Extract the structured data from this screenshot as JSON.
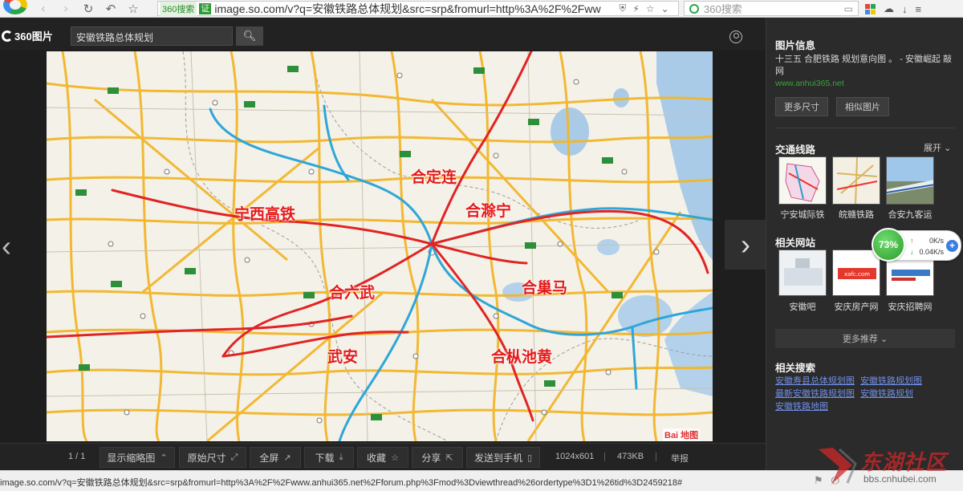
{
  "browser": {
    "url_tag": "360搜索",
    "url_badge": "证",
    "url_text": "image.so.com/v?q=安徽铁路总体规划&src=srp&fromurl=http%3A%2F%2Fww",
    "search_placeholder": "360搜索"
  },
  "site": {
    "logo": "360图片",
    "search_value": "安徽铁路总体规划"
  },
  "map": {
    "labels": [
      "合定连",
      "宁西高铁",
      "合滁宁",
      "合六武",
      "合巢马",
      "武安",
      "合枞池黄"
    ],
    "brand": "Bai 地图"
  },
  "bottom_bar": {
    "page_count": "1 / 1",
    "buttons": [
      "显示缩略图",
      "原始尺寸",
      "全屏",
      "下载",
      "收藏",
      "分享",
      "发送到手机"
    ],
    "dimensions": "1024x601",
    "size": "473KB",
    "report": "举报"
  },
  "sidebar": {
    "info_title": "图片信息",
    "description": "十三五 合肥铁路 规划意向图 。 - 安徽崛起 敲网",
    "source_link": "www.anhui365.net",
    "more_sizes": "更多尺寸",
    "similar": "相似图片",
    "traffic_title": "交通线路",
    "expand": "展开",
    "traffic_items": [
      "宁安城际铁",
      "皖赣铁路",
      "合安九客运"
    ],
    "sites_title": "相关网站",
    "site_items": [
      "安徽吧",
      "安庆房产网",
      "安庆招聘网"
    ],
    "more_recommend": "更多推荐",
    "related_title": "相关搜索",
    "related_links": [
      "安徽寿县总体规划图",
      "安徽铁路规划图",
      "最新安徽铁路规划图",
      "安徽铁路规划",
      "安徽铁路地图"
    ]
  },
  "speed": {
    "percent": "73%",
    "up": "0K/s",
    "down": "0.04K/s"
  },
  "status": {
    "url": "image.so.com/v?q=安徽铁路总体规划&src=srp&fromurl=http%3A%2F%2Fwww.anhui365.net%2Fforum.php%3Fmod%3Dviewthread%26ordertype%3D1%26tid%3D2459218#"
  },
  "watermark": {
    "title": "东湖社区",
    "url": "bbs.cnhubei.com"
  },
  "colors": {
    "rail_red": "#e02424",
    "rail_blue": "#2fa6d8",
    "accent_green": "#2c9a34",
    "link_blue": "#6f8fe8"
  }
}
